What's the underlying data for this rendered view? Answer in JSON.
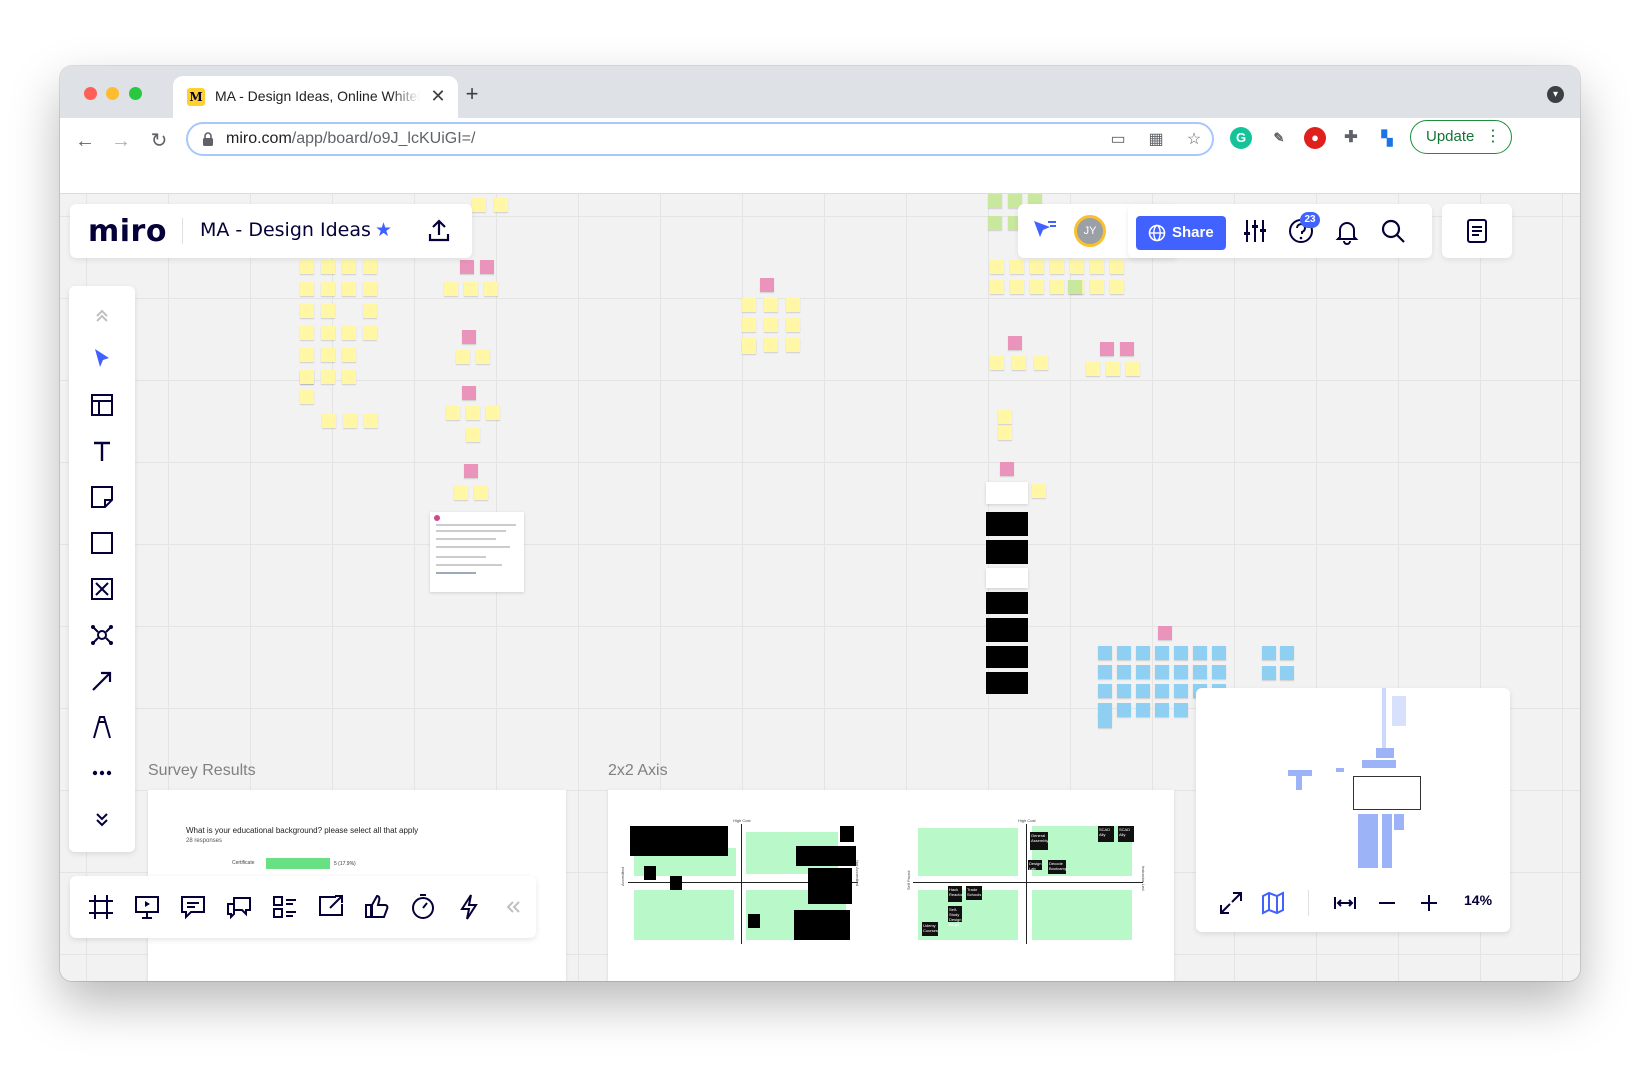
{
  "browser": {
    "tab_title": "MA - Design Ideas, Online Whiteboard",
    "tab_close": "✕",
    "new_tab": "+",
    "url_host": "miro.com",
    "url_path": "/app/board/o9J_lcKUiGI=/",
    "update_label": "Update",
    "nav": {
      "back": "←",
      "forward": "→",
      "reload": "↻"
    },
    "extension_icons": [
      "grammarly-icon",
      "eyedropper-icon",
      "adblock-icon",
      "extensions-puzzle-icon",
      "extension-blue-icon"
    ]
  },
  "board_header": {
    "logo": "miro",
    "board_name": "MA - Design Ideas",
    "star": "★"
  },
  "collaboration": {
    "avatar_initials": "JY",
    "share_label": "Share",
    "help_badge": "23"
  },
  "frames": {
    "survey_title": "Survey Results",
    "axis_title": "2x2 Axis",
    "survey_question": "What is your educational background? please select all that apply",
    "survey_responses": "28 responses",
    "survey_category": "Certificate",
    "survey_bar_value": "5 (17.9%)",
    "survey_bar_fraction": 0.179,
    "axis_labels": {
      "high_cost": "High Cost",
      "low_cost": "Low Cost",
      "accredited": "Accredited",
      "not_accredited": "Not Accredited",
      "self_paced": "Self Paced",
      "instructor_led": "Instructor Led"
    },
    "axis2_tags": [
      "SCAD Ally",
      "Decode Bootcamp",
      "General Assembly",
      "Design Lab",
      "Hack Reactor",
      "Trade Schools",
      "Self-Study Design Blogs",
      "Udemy Courses"
    ]
  },
  "minimap": {
    "zoom_level": "14%"
  },
  "colors": {
    "accent": "#4262ff",
    "brand_dark": "#050038",
    "sticky_yellow": "#fff6a6",
    "sticky_pink": "#ea94bb",
    "sticky_blue": "#8fd0f2",
    "sticky_green": "#c8e89d",
    "axis_green": "#b8f8c9",
    "survey_bar": "#69e083"
  }
}
